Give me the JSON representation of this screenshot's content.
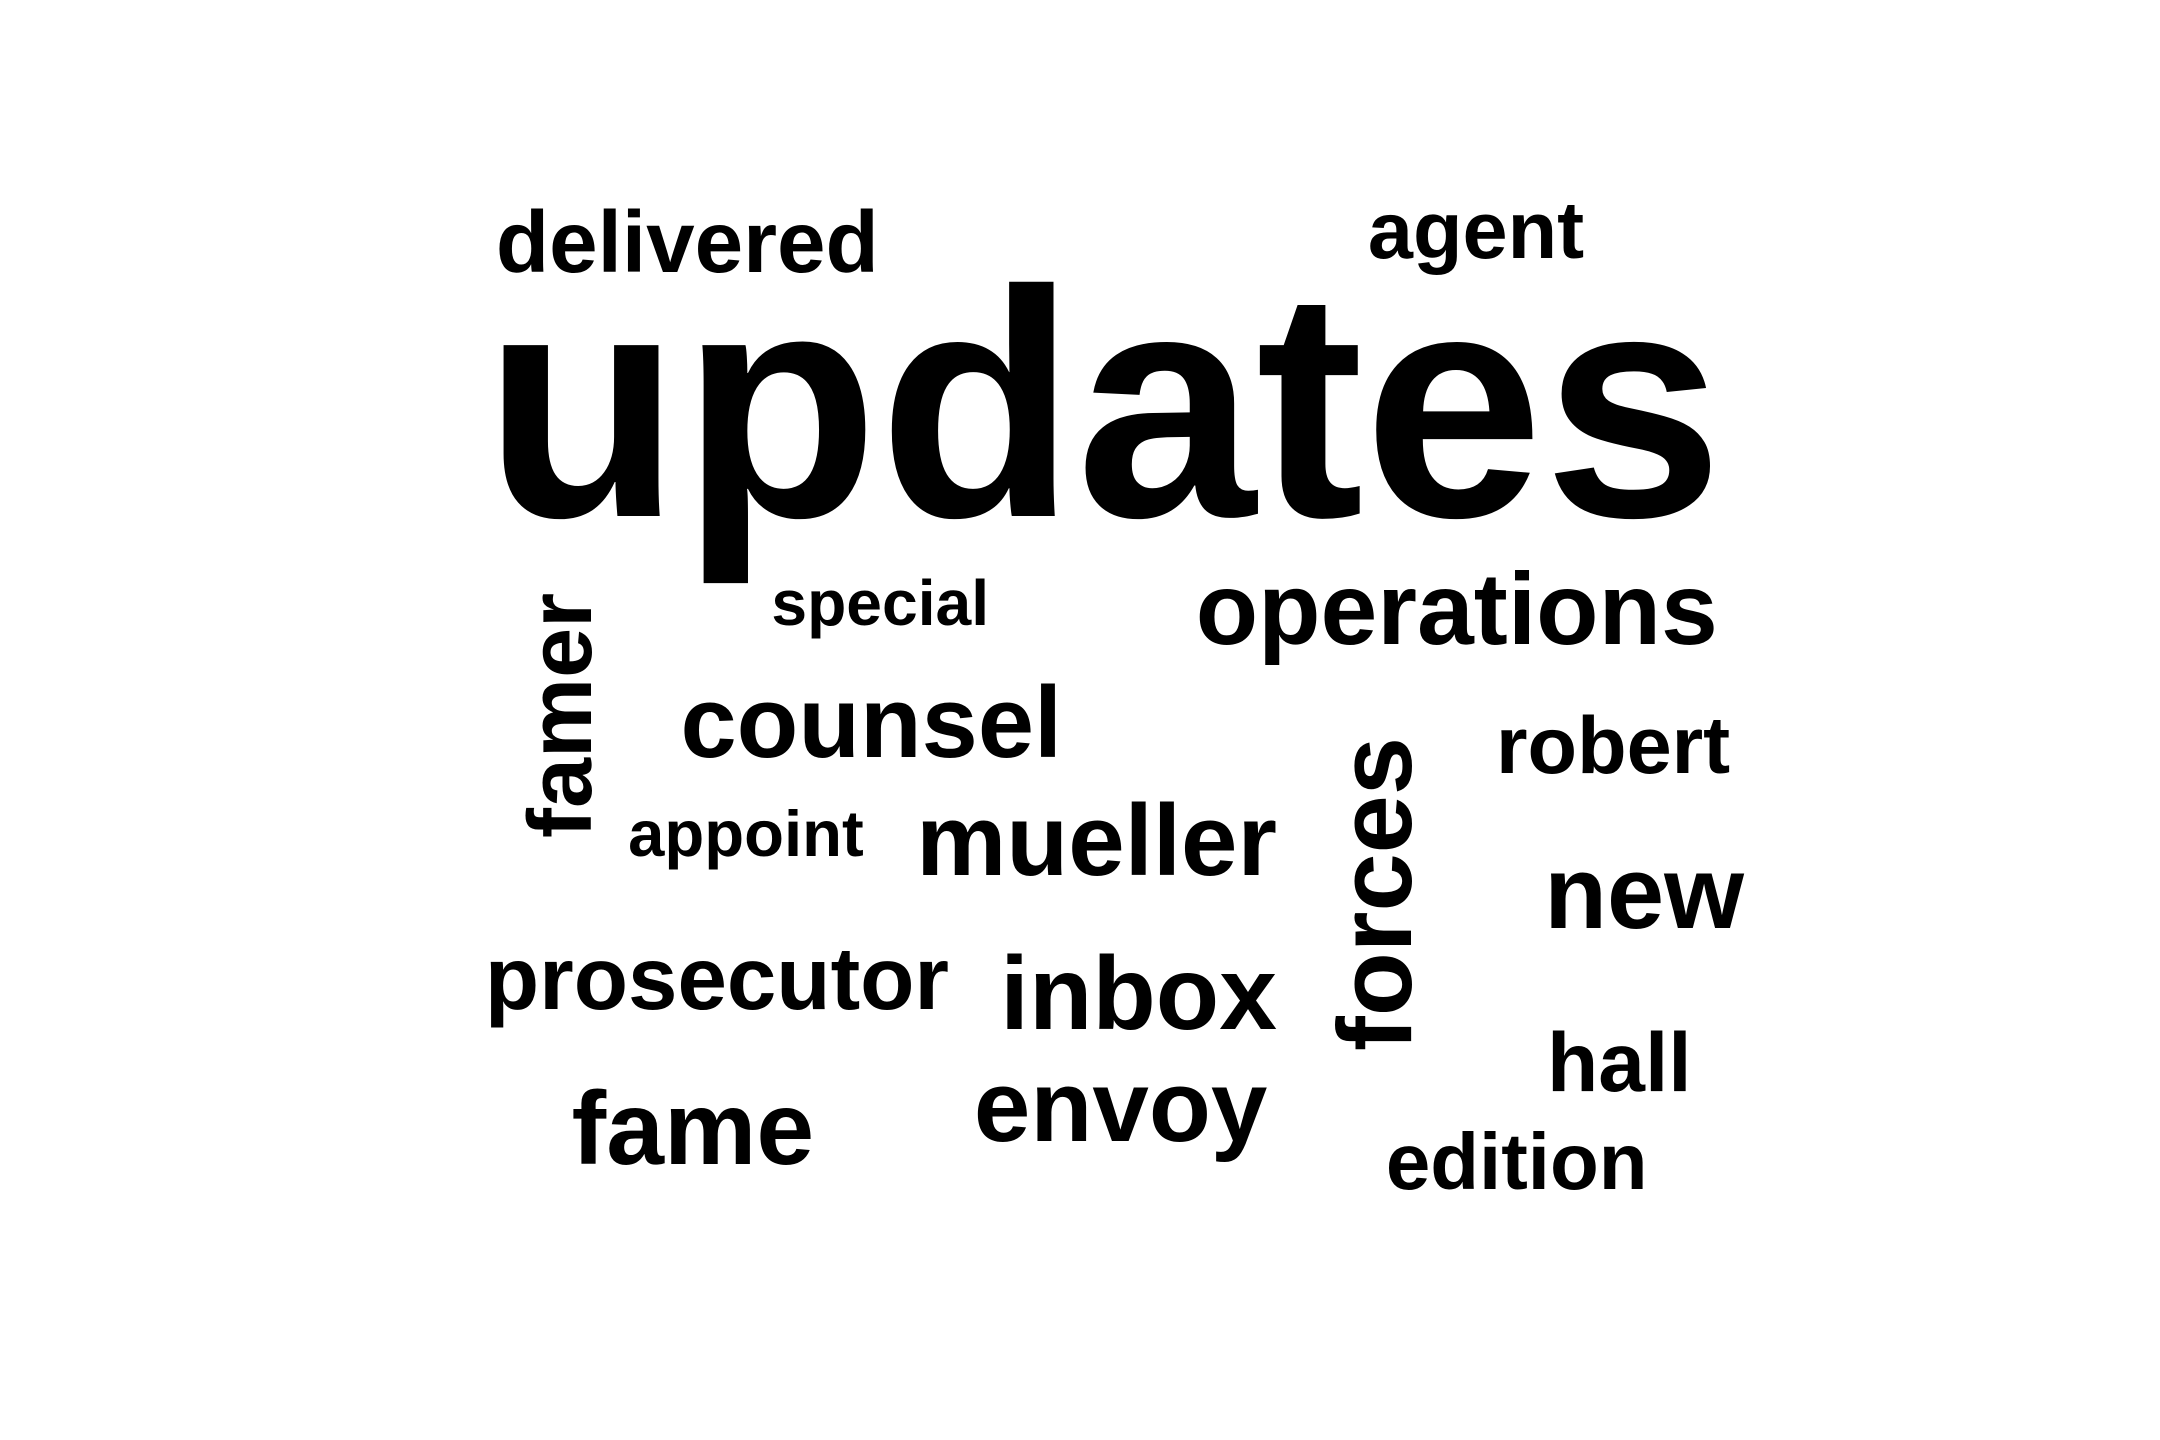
{
  "word_cloud": {
    "text_color": "#000000",
    "background": "#ffffff",
    "words": [
      {
        "text": "updates",
        "orientation": "horizontal"
      },
      {
        "text": "delivered",
        "orientation": "horizontal"
      },
      {
        "text": "agent",
        "orientation": "horizontal"
      },
      {
        "text": "special",
        "orientation": "horizontal"
      },
      {
        "text": "operations",
        "orientation": "horizontal"
      },
      {
        "text": "famer",
        "orientation": "vertical"
      },
      {
        "text": "counsel",
        "orientation": "horizontal"
      },
      {
        "text": "robert",
        "orientation": "horizontal"
      },
      {
        "text": "appoint",
        "orientation": "horizontal"
      },
      {
        "text": "mueller",
        "orientation": "horizontal"
      },
      {
        "text": "forces",
        "orientation": "vertical"
      },
      {
        "text": "new",
        "orientation": "horizontal"
      },
      {
        "text": "prosecutor",
        "orientation": "horizontal"
      },
      {
        "text": "inbox",
        "orientation": "horizontal"
      },
      {
        "text": "hall",
        "orientation": "horizontal"
      },
      {
        "text": "fame",
        "orientation": "horizontal"
      },
      {
        "text": "envoy",
        "orientation": "horizontal"
      },
      {
        "text": "edition",
        "orientation": "horizontal"
      }
    ]
  }
}
